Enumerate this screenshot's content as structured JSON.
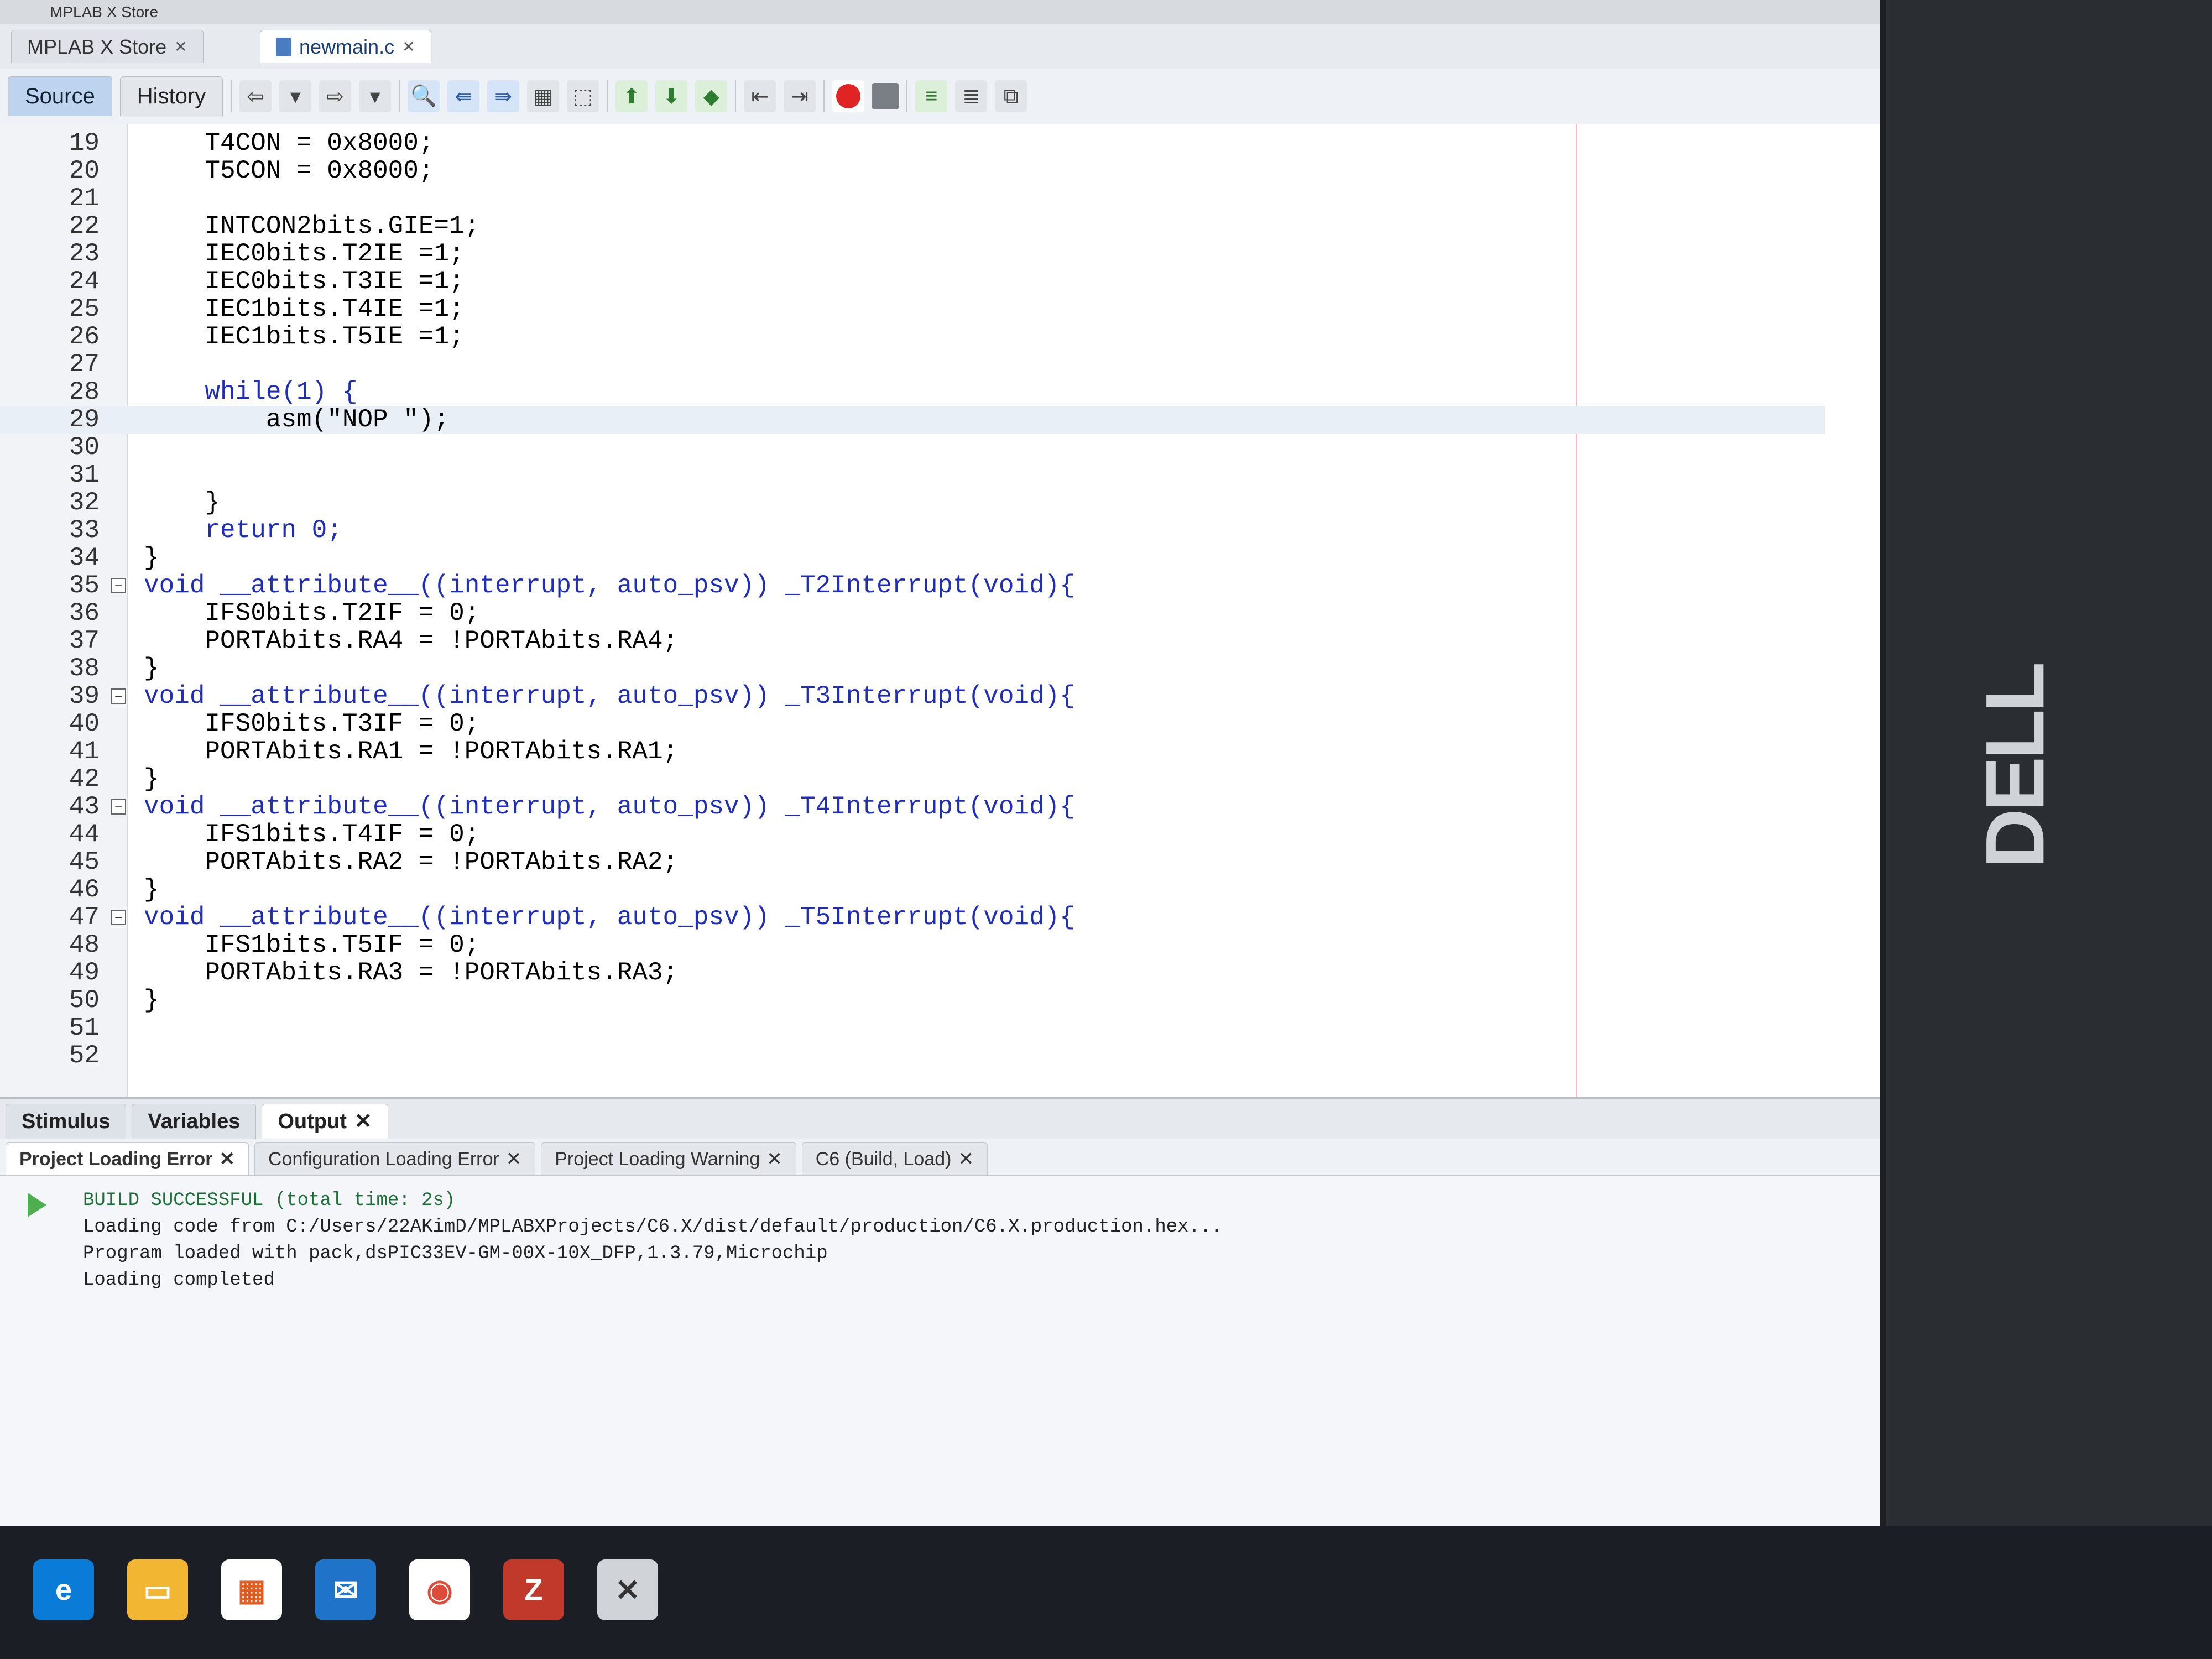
{
  "window": {
    "title": "MPLAB X Store"
  },
  "tabs": [
    {
      "label": "MPLAB X Store"
    },
    {
      "label": "newmain.c"
    }
  ],
  "views": {
    "source": "Source",
    "history": "History"
  },
  "editor": {
    "lines": [
      {
        "n": "19",
        "text": "    T4CON = 0x8000;"
      },
      {
        "n": "20",
        "text": "    T5CON = 0x8000;"
      },
      {
        "n": "21",
        "text": ""
      },
      {
        "n": "22",
        "text": "    INTCON2bits.GIE=1;"
      },
      {
        "n": "23",
        "text": "    IEC0bits.T2IE =1;"
      },
      {
        "n": "24",
        "text": "    IEC0bits.T3IE =1;"
      },
      {
        "n": "25",
        "text": "    IEC1bits.T4IE =1;"
      },
      {
        "n": "26",
        "text": "    IEC1bits.T5IE =1;"
      },
      {
        "n": "27",
        "text": ""
      },
      {
        "n": "28",
        "text": "    while(1) {"
      },
      {
        "n": "29",
        "text": "        asm(\"NOP \");"
      },
      {
        "n": "30",
        "text": ""
      },
      {
        "n": "31",
        "text": ""
      },
      {
        "n": "32",
        "text": "    }"
      },
      {
        "n": "33",
        "text": "    return 0;"
      },
      {
        "n": "34",
        "text": "}"
      },
      {
        "n": "35",
        "text": "void __attribute__((interrupt, auto_psv)) _T2Interrupt(void){"
      },
      {
        "n": "36",
        "text": "    IFS0bits.T2IF = 0;"
      },
      {
        "n": "37",
        "text": "    PORTAbits.RA4 = !PORTAbits.RA4;"
      },
      {
        "n": "38",
        "text": "}"
      },
      {
        "n": "39",
        "text": "void __attribute__((interrupt, auto_psv)) _T3Interrupt(void){"
      },
      {
        "n": "40",
        "text": "    IFS0bits.T3IF = 0;"
      },
      {
        "n": "41",
        "text": "    PORTAbits.RA1 = !PORTAbits.RA1;"
      },
      {
        "n": "42",
        "text": "}"
      },
      {
        "n": "43",
        "text": "void __attribute__((interrupt, auto_psv)) _T4Interrupt(void){"
      },
      {
        "n": "44",
        "text": "    IFS1bits.T4IF = 0;"
      },
      {
        "n": "45",
        "text": "    PORTAbits.RA2 = !PORTAbits.RA2;"
      },
      {
        "n": "46",
        "text": "}"
      },
      {
        "n": "47",
        "text": "void __attribute__((interrupt, auto_psv)) _T5Interrupt(void){"
      },
      {
        "n": "48",
        "text": "    IFS1bits.T5IF = 0;"
      },
      {
        "n": "49",
        "text": "    PORTAbits.RA3 = !PORTAbits.RA3;"
      },
      {
        "n": "50",
        "text": "}"
      },
      {
        "n": "51",
        "text": ""
      },
      {
        "n": "52",
        "text": ""
      }
    ]
  },
  "panel": {
    "tabs": [
      {
        "label": "Stimulus"
      },
      {
        "label": "Variables"
      },
      {
        "label": "Output"
      }
    ],
    "subtabs": [
      {
        "label": "Project Loading Error"
      },
      {
        "label": "Configuration Loading Error"
      },
      {
        "label": "Project Loading Warning"
      },
      {
        "label": "C6 (Build, Load)"
      }
    ],
    "output_lines": [
      "BUILD SUCCESSFUL (total time: 2s)",
      "Loading code from C:/Users/22AKimD/MPLABXProjects/C6.X/dist/default/production/C6.X.production.hex...",
      "Program loaded with pack,dsPIC33EV-GM-00X-10X_DFP,1.3.79,Microchip",
      "Loading completed"
    ]
  },
  "monitor_brand": "DELL",
  "colors": {
    "keyword": "#1f2db8",
    "success": "#1f6f3a",
    "accent_tab": "#bdd3ee"
  }
}
